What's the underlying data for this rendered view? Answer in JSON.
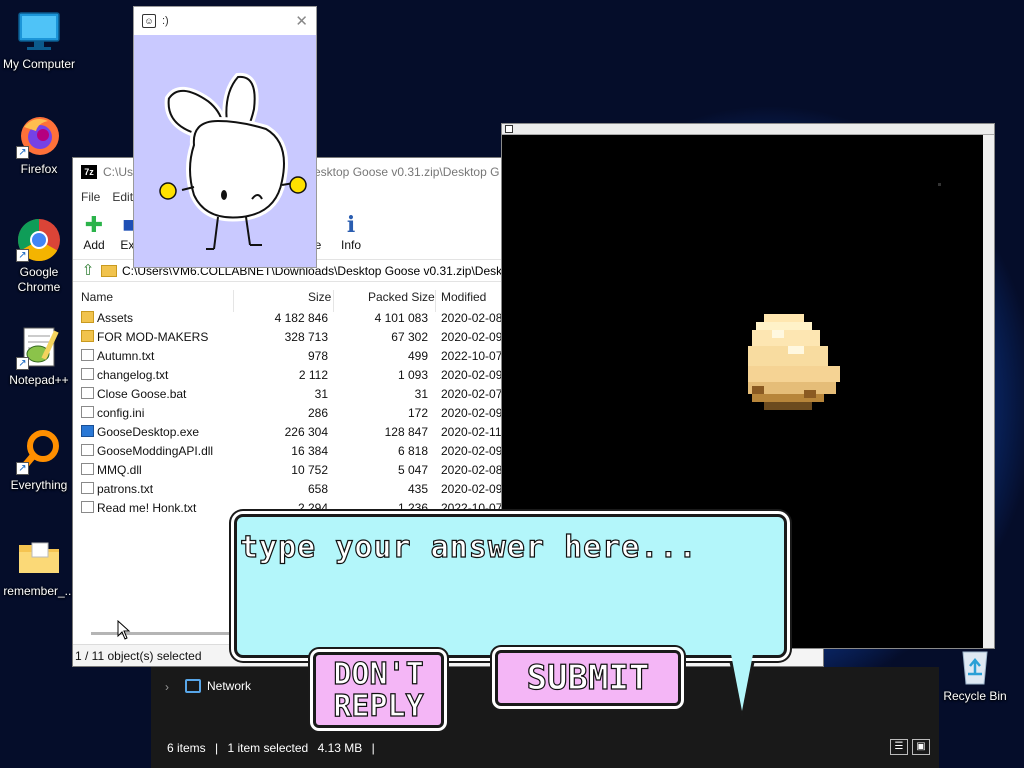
{
  "desktop": {
    "icons": [
      {
        "label": "My Computer",
        "icon": "monitor-icon"
      },
      {
        "label": "Firefox",
        "icon": "firefox-icon"
      },
      {
        "label": "Google Chrome",
        "icon": "chrome-icon"
      },
      {
        "label": "Notepad++",
        "icon": "notepadpp-icon"
      },
      {
        "label": "Everything",
        "icon": "magnifier-icon"
      },
      {
        "label": "remember_...",
        "icon": "folder-icon"
      }
    ],
    "recycle_bin": {
      "label": "Recycle Bin",
      "icon": "recycle-bin-icon"
    }
  },
  "zip_window": {
    "title": "C:\\Use",
    "title_tail": "esktop Goose v0.31.zip\\Desktop G",
    "menu": [
      "File",
      "Edit"
    ],
    "toolbar": {
      "add": "Add",
      "extract": "Ext",
      "test": "e",
      "info": "Info"
    },
    "path": "C:\\Users\\VM6.COLLABNET\\Downloads\\Desktop Goose v0.31.zip\\Deskt",
    "columns": {
      "name": "Name",
      "size": "Size",
      "packed": "Packed Size",
      "modified": "Modified"
    },
    "rows": [
      {
        "name": "Assets",
        "size": "4 182 846",
        "packed": "4 101 083",
        "modified": "2020-02-08",
        "kind": "folder"
      },
      {
        "name": "FOR MOD-MAKERS",
        "size": "328 713",
        "packed": "67 302",
        "modified": "2020-02-09",
        "kind": "folder"
      },
      {
        "name": "Autumn.txt",
        "size": "978",
        "packed": "499",
        "modified": "2022-10-07",
        "kind": "file"
      },
      {
        "name": "changelog.txt",
        "size": "2 112",
        "packed": "1 093",
        "modified": "2020-02-09",
        "kind": "file"
      },
      {
        "name": "Close Goose.bat",
        "size": "31",
        "packed": "31",
        "modified": "2020-02-07",
        "kind": "file"
      },
      {
        "name": "config.ini",
        "size": "286",
        "packed": "172",
        "modified": "2020-02-09",
        "kind": "file"
      },
      {
        "name": "GooseDesktop.exe",
        "size": "226 304",
        "packed": "128 847",
        "modified": "2020-02-11",
        "kind": "exe"
      },
      {
        "name": "GooseModdingAPI.dll",
        "size": "16 384",
        "packed": "6 818",
        "modified": "2020-02-09",
        "kind": "file"
      },
      {
        "name": "MMQ.dll",
        "size": "10 752",
        "packed": "5 047",
        "modified": "2020-02-08",
        "kind": "file"
      },
      {
        "name": "patrons.txt",
        "size": "658",
        "packed": "435",
        "modified": "2020-02-09",
        "kind": "file"
      },
      {
        "name": "Read me! Honk.txt",
        "size": "2 294",
        "packed": "1 236",
        "modified": "2022-10-07",
        "kind": "file"
      }
    ],
    "status": "1 / 11 object(s) selected"
  },
  "bunny_window": {
    "title": ":)"
  },
  "explorer": {
    "nav_item": "Network",
    "items_count": "6 items",
    "selection": "1 item selected",
    "selection_size": "4.13 MB",
    "separator": "|"
  },
  "goose_prompt": {
    "placeholder": "type your answer here...",
    "dont_reply": "DON'T REPLY",
    "submit": "SUBMIT"
  },
  "colors": {
    "bubble_fill": "#b3f6fa",
    "button_fill": "#f4b6f6",
    "bunny_bg": "#c9c9ff",
    "desktop_accent": "#1a6fe0"
  }
}
